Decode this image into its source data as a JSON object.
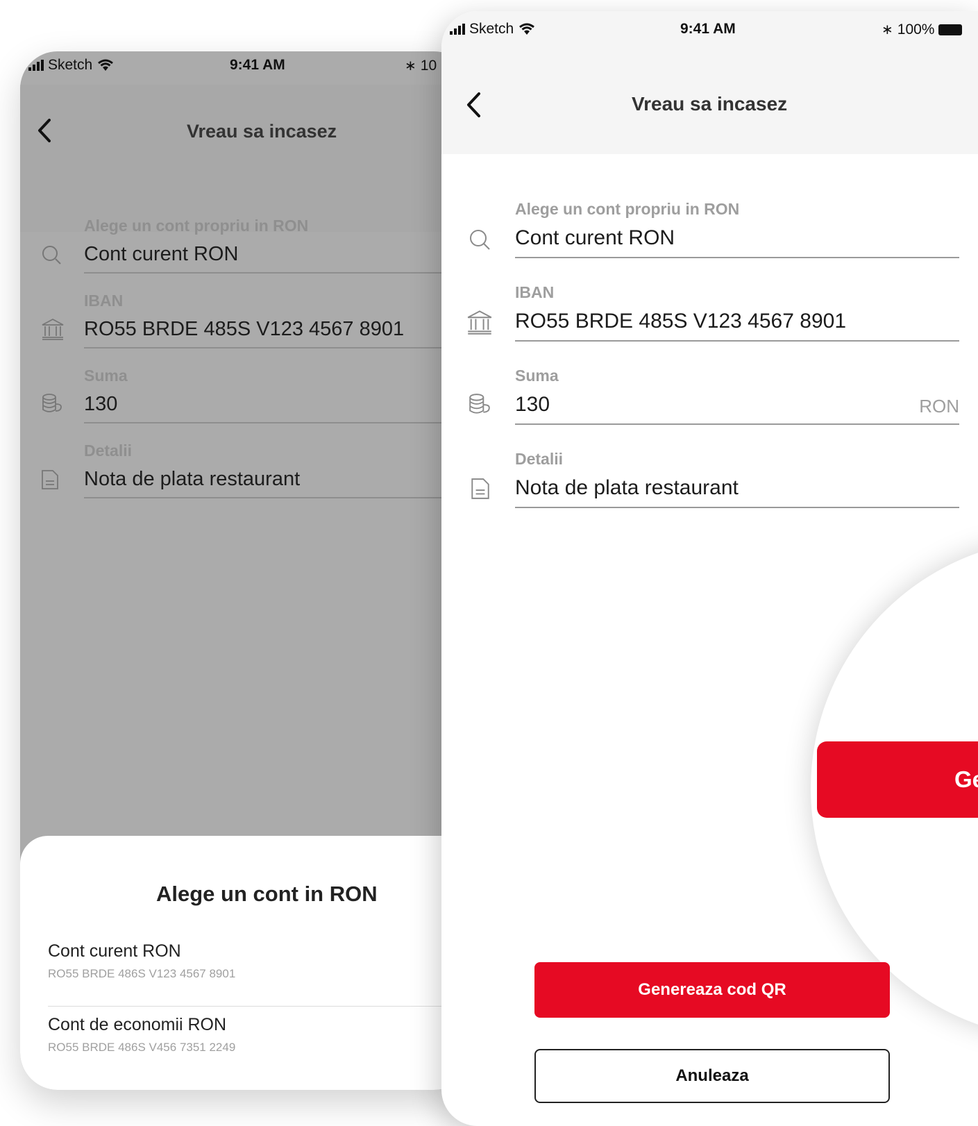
{
  "back_screen": {
    "status_bar": {
      "carrier": "Sketch",
      "time": "9:41 AM",
      "battery": "10"
    },
    "header": {
      "title": "Vreau sa incasez"
    },
    "fields": [
      {
        "label": "Alege un cont propriu in RON",
        "value": "Cont curent RON",
        "icon": "search-icon"
      },
      {
        "label": "IBAN",
        "value": "RO55 BRDE 485S V123 4567 8901",
        "icon": "bank-icon"
      },
      {
        "label": "Suma",
        "value": "130",
        "icon": "coins-icon"
      },
      {
        "label": "Detalii",
        "value": "Nota de plata restaurant",
        "icon": "document-icon"
      }
    ],
    "sheet": {
      "title": "Alege un cont in RON",
      "accounts": [
        {
          "name": "Cont curent RON",
          "iban": "RO55 BRDE 486S V123 4567 8901"
        },
        {
          "name": "Cont de economii RON",
          "iban": "RO55 BRDE 486S V456 7351 2249"
        }
      ]
    }
  },
  "front_screen": {
    "status_bar": {
      "carrier": "Sketch",
      "time": "9:41 AM",
      "battery": "100%"
    },
    "header": {
      "title": "Vreau sa incasez"
    },
    "fields": [
      {
        "label": "Alege un cont propriu in RON",
        "value": "Cont curent RON",
        "icon": "search-icon"
      },
      {
        "label": "IBAN",
        "value": "RO55 BRDE 485S V123 4567 8901",
        "icon": "bank-icon"
      },
      {
        "label": "Suma",
        "value": "130",
        "unit": "RON",
        "icon": "coins-icon"
      },
      {
        "label": "Detalii",
        "value": "Nota de plata restaurant",
        "icon": "document-icon"
      }
    ],
    "magnified_button_label": "Ge",
    "primary_button": "Genereaza cod QR",
    "secondary_button": "Anuleaza"
  },
  "colors": {
    "accent": "#e60a23",
    "overlay": "#ababab",
    "label": "#9e9e9e"
  }
}
